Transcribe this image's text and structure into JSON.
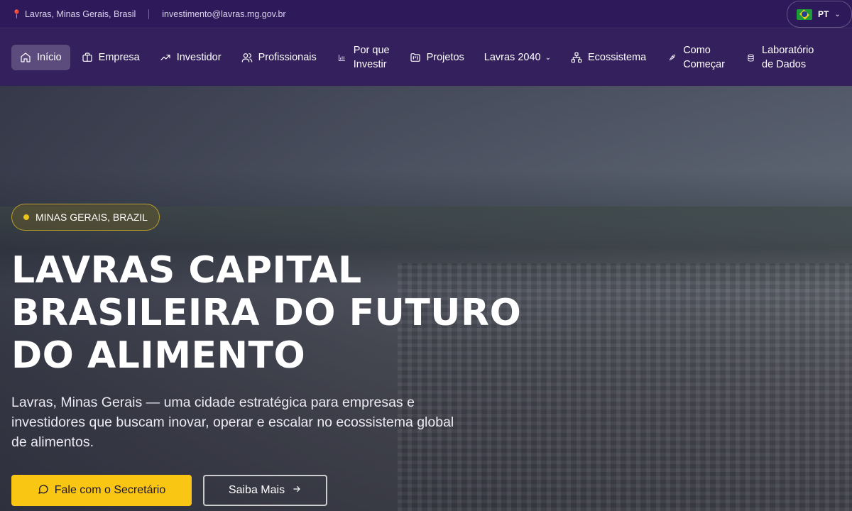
{
  "topbar": {
    "location": "Lavras, Minas Gerais, Brasil",
    "email": "investimento@lavras.mg.gov.br",
    "language": "PT"
  },
  "nav": {
    "items": [
      {
        "label": "Início",
        "icon": "home-icon"
      },
      {
        "label": "Empresa",
        "icon": "briefcase-icon"
      },
      {
        "label": "Investidor",
        "icon": "trending-up-icon"
      },
      {
        "label": "Profissionais",
        "icon": "users-icon"
      },
      {
        "label_line1": "Por que",
        "label_line2": "Investir",
        "icon": "bar-chart-icon"
      },
      {
        "label": "Projetos",
        "icon": "folder-kanban-icon"
      },
      {
        "label": "Lavras 2040",
        "icon": "chevron-down-icon"
      },
      {
        "label": "Ecossistema",
        "icon": "network-icon"
      },
      {
        "label_line1": "Como",
        "label_line2": "Começar",
        "icon": "rocket-icon"
      },
      {
        "label_line1": "Laboratório",
        "label_line2": "de Dados",
        "icon": "database-icon"
      }
    ]
  },
  "hero": {
    "badge": "MINAS GERAIS, BRAZIL",
    "title_line1": "LAVRAS CAPITAL",
    "title_line2": "BRASILEIRA DO FUTURO",
    "title_line3": "DO ALIMENTO",
    "subtitle": "Lavras, Minas Gerais — uma cidade estratégica para empresas e investidores que buscam inovar, operar e escalar no ecossistema global de alimentos.",
    "primary_cta": "Fale com o Secretário",
    "secondary_cta": "Saiba Mais"
  },
  "colors": {
    "header_bg": "#2e1a5a",
    "accent_yellow": "#f9c614"
  }
}
